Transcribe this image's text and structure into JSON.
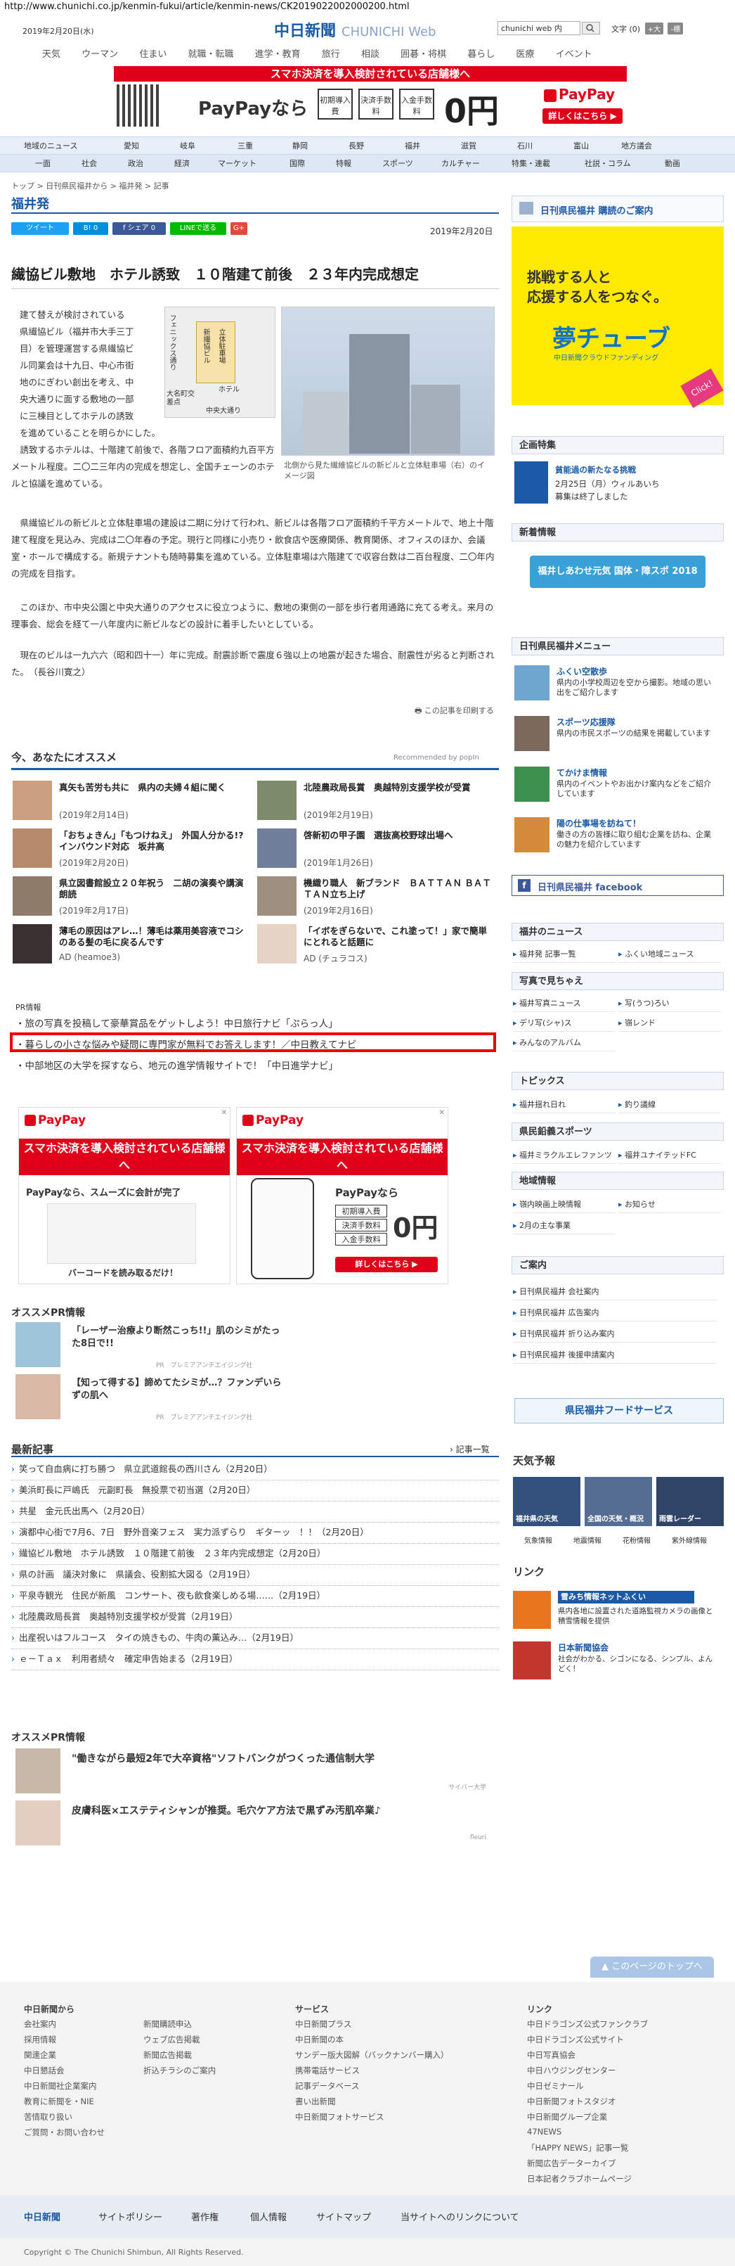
{
  "browser": {
    "url": "http://www.chunichi.co.jp/kenmin-fukui/article/kenmin-news/CK2019022002000200.html"
  },
  "header": {
    "date": "2019年2月20日(水)",
    "logo": "中日新聞",
    "logo_sub": "CHUNICHI Web",
    "search_value": "chunichi web 内",
    "font_size_label": "文字",
    "font_size_value": "(0)",
    "font_bigger": "+大",
    "font_smaller": "-標"
  },
  "global_nav": [
    "天気",
    "ウーマン",
    "住まい",
    "就職・転職",
    "進学・教育",
    "旅行",
    "相談",
    "囲碁・将棋",
    "暮らし",
    "医療",
    "イベント"
  ],
  "top_banner": {
    "red_text": "スマホ決済を導入検討されている店舗様へ",
    "brand": "PayPay",
    "brand_prefix": "PayPayなら",
    "badges": [
      "初期導入費",
      "決済手数料",
      "入金手数料"
    ],
    "price": "0円",
    "cta": "詳しくはこちら ▶"
  },
  "nav_primary": [
    "地域のニュース",
    "愛知",
    "岐阜",
    "三重",
    "静岡",
    "長野",
    "福井",
    "滋賀",
    "石川",
    "富山",
    "地方議会"
  ],
  "nav_secondary": [
    "一面",
    "社会",
    "政治",
    "経済",
    "マーケット",
    "国際",
    "特報",
    "スポーツ",
    "カルチャー",
    "特集・連載",
    "社説・コラム",
    "動画"
  ],
  "breadcrumb": "トップ > 日刊県民福井から > 福井発 > 記事",
  "section_title": "福井発",
  "share_buttons": [
    {
      "label": "ツイート",
      "color": "#1da1f2"
    },
    {
      "label": "B! 0",
      "color": "#008fde"
    },
    {
      "label": "f シェア 0",
      "color": "#3b5998"
    },
    {
      "label": "LINEで送る",
      "color": "#00b900"
    },
    {
      "label": "G+",
      "color": "#dd4b39"
    }
  ],
  "article": {
    "date": "2019年2月20日",
    "headline": "繊協ビル敷地　ホテル誘致　１０階建て前後　２３年内完成想定",
    "para1_lines": [
      "建て替えが検討されている",
      "県繊協ビル（福井市大手三丁",
      "目）を管理運営する県繊協ビ",
      "ル同業会は十九日、中心市街",
      "地のにぎわい創出を考え、中",
      "央大通りに面する敷地の一部",
      "に三棟目としてホテルの誘致",
      "を進めていることを明らかにした。"
    ],
    "para2": "誘致するホテルは、十階建て前後で、各階フロア面積約九百平方メートル程度。二〇二三年内の完成を想定し、全国チェーンのホテルと協議を進めている。",
    "para3": "県繊協ビルの新ビルと立体駐車場の建設は二期に分けて行われ、新ビルは各階フロア面積約千平方メートルで、地上十階建て程度を見込み、完成は二〇年春の予定。現行と同様に小売り・飲食店や医療関係、教育関係、オフィスのほか、会議室・ホールで構成する。新規テナントも随時募集を進めている。立体駐車場は六階建てで収容台数は二百台程度、二〇年内の完成を目指す。",
    "para4": "このほか、市中央公園と中央大通りのアクセスに役立つように、敷地の東側の一部を歩行者用通路に充てる考え。来月の理事会、総会を経て一八年度内に新ビルなどの設計に着手したいとしている。",
    "para5": "現在のビルは一九六六（昭和四十一）年に完成。耐震診断で震度６強以上の地震が起きた場合、耐震性が劣ると判断された。　（長谷川寛之）",
    "map_labels": [
      "フェニックス通り",
      "新繊協ビル",
      "立体駐車場",
      "大名町交差点",
      "ホテル",
      "中央大通り"
    ],
    "photo_caption": "北側から見た繊維協ビルの新ビルと立体駐車場（右）のイメージ図",
    "print_link": "この記事を印刷する"
  },
  "recommend": {
    "title": "今、あなたにオススメ",
    "powered": "Recommended by popIn",
    "items": [
      {
        "title": "真矢も苦労も共に　県内の夫婦４組に聞く",
        "date": "(2019年2月14日)"
      },
      {
        "title": "北陸農政局長賞　奥越特別支援学校が受賞",
        "date": "(2019年2月19日)"
      },
      {
        "title": "「おちょきん」「もつけねえ」　外国人分かる!?　インバウンド対応　坂井高",
        "date": "(2019年2月20日)"
      },
      {
        "title": "啓新初の甲子園　選抜高校野球出場へ",
        "date": "(2019年1月26日)"
      },
      {
        "title": "県立図書館設立２０年祝う　二胡の演奏や講演朗読",
        "date": "(2019年2月17日)"
      },
      {
        "title": "機織り職人　新ブランド　ＢＡＴＴＡＮ ＢＡＴＴＡＮ立ち上げ",
        "date": "(2019年2月16日)"
      },
      {
        "title": "薄毛の原因はアレ…！薄毛は薬用美容液でコシのある髪の毛に戻るんです",
        "date": "AD (heamoe3)"
      },
      {
        "title": "「イボをぎらないで、これ塗って！」家で簡単にとれると話題に",
        "date": "AD (チュラコス)"
      }
    ]
  },
  "pr_info": {
    "label": "PR情報",
    "links": [
      "旅の写真を投稿して豪華賞品をゲットしよう！中日旅行ナビ「ぷらっ人」",
      "暮らしの小さな悩みや疑問に専門家が無料でお答えします！／中日教えてナビ",
      "中部地区の大学を探すなら、地元の進学情報サイトで！「中日進学ナビ」"
    ]
  },
  "paypay_ads": [
    {
      "brand": "PayPay",
      "red_text": "スマホ決済を導入検討されている店舗様へ",
      "sub": "PayPayなら、スムーズに会計が完了",
      "note": "バーコードを読み取るだけ！"
    },
    {
      "brand": "PayPay",
      "red_text": "スマホ決済を導入検討されている店舗様へ",
      "sub": "PayPayなら",
      "badges": [
        "初期導入費",
        "決済手数料",
        "入金手数料"
      ],
      "price": "0円",
      "cta": "詳しくはこちら ▶"
    }
  ],
  "pr_recommend_1": {
    "title": "オススメPR情報",
    "items": [
      {
        "title": "「レーザー治療より断然こっち!!」肌のシミがたった8日で!!",
        "source": "PR　プレミアアンチエイジング社"
      },
      {
        "title": "【知って得する】諦めてたシミが…？ファンデいらずの肌へ",
        "source": "PR　プレミアアンチエイジング社"
      }
    ]
  },
  "latest": {
    "title": "最新記事",
    "more": "› 記事一覧",
    "items": [
      "笑って自血病に打ち勝つ　県立武道館長の西川さん（2月20日）",
      "美浜町長に戸嶋氏　元副町長　無投票で初当選（2月20日）",
      "共星　金元氏出馬へ（2月20日）",
      "演都中心街で7月6、7日　野外音楽フェス　実力派ずらり　ギターッ　！！（2月20日）",
      "繊協ビル敷地　ホテル誘致　１０階建て前後　２３年内完成想定（2月20日）",
      "県の計画　議決対象に　県議会、役割拡大図る（2月19日）",
      "平泉寺観光　住民が新風　コンサート、夜も飲食楽しめる場……（2月19日）",
      "北陸農政局長賞　奥越特別支援学校が受賞（2月19日）",
      "出産祝いはフルコース　タイの焼きもの、牛肉の薫込み…（2月19日）",
      "ｅ－Ｔａｘ　利用者続々　確定申告始まる（2月19日）"
    ]
  },
  "pr_recommend_2": {
    "title": "オススメPR情報",
    "items": [
      {
        "title": "\"働きながら最短2年で大卒資格\"ソフトバンクがつくった通信制大学",
        "source": "サイバー大学"
      },
      {
        "title": "皮膚科医×エステティシャンが推奨。毛穴ケア方法で黒ずみ汚肌卒業♪",
        "source": "fleuri"
      }
    ]
  },
  "sidebar": {
    "purchase_title": "日刊県民福井 購読のご案内",
    "yume_ad": {
      "line1": "挑戦する人と",
      "line2": "応援する人をつなぐ。",
      "brand": "夢チューブ",
      "sub": "中日新聞クラウドファンディング",
      "click": "Click!"
    },
    "feature_title": "企画特集",
    "feature_item": {
      "title": "貧能過の新たなる挑戦",
      "date": "2月25日（月）ウィルあいち",
      "desc": "募集は終了しました"
    },
    "new_info_title": "新着情報",
    "new_info_banner": "福井しあわせ元気 国体・障スポ 2018",
    "menu_title": "日刊県民福井メニュー",
    "menu_items": [
      {
        "title": "ふくい空散歩",
        "desc": "県内の小学校周辺を空から撮影。地域の思い出をご紹介します"
      },
      {
        "title": "スポーツ応援隊",
        "desc": "県内の市民スポーツの結果を掲載しています"
      },
      {
        "title": "てかけま情報",
        "desc": "県内のイベントやお出かけ案内などをご紹介しています"
      },
      {
        "title": "陽の仕事場を訪ねて！",
        "desc": "働きの方の皆様に取り組む企業を訪ね、企業の魅力を紹介しています"
      }
    ],
    "facebook": "日刊県民福井 facebook",
    "fukui_news_title": "福井のニュース",
    "fukui_news": [
      "福井発 記事一覧",
      "ふくい地域ニュース"
    ],
    "photo_title": "写真で見ちゃえ",
    "photo_items": [
      "福井写真ニュース",
      "写(うつ)ろい",
      "デリ写(シャ)ス",
      "嶺レンド",
      "みんなのアルバム"
    ],
    "topics_title": "トピックス",
    "topics_items": [
      "福井揺れ日れ",
      "釣り議線"
    ],
    "sports_title": "県民鉛義スポーツ",
    "sports_items": [
      "福井ミラクルエレファンツ",
      "福井ユナイテッドFC"
    ],
    "region_title": "地域情報",
    "region_items": [
      "嶺内映画上映情報",
      "お知らせ",
      "2月の主な事業"
    ],
    "guide_title": "ご案内",
    "guide_items": [
      "日刊県民福井 会社案内",
      "日刊県民福井 広告案内",
      "日刊県民福井 折り込み案内",
      "日刊県民福井 後援申請案内"
    ],
    "service_banner": "県民福井フードサービス",
    "weather_title": "天気予報",
    "weather_tiles": [
      "福井県の天気",
      "全国の天気・概況",
      "雨雲レーダー"
    ],
    "weather_links": [
      "気象情報",
      "地震情報",
      "花粉情報",
      "紫外線情報"
    ],
    "link_title": "リンク",
    "link_items": [
      {
        "title": "雪みち情報ネットふくい",
        "desc": "県内各地に設置された道路監視カメラの画像と積雪情報を提供"
      },
      {
        "title": "日本新聞協会",
        "desc": "社会がわかる、シゴンになる、シンプル、よんどく！"
      }
    ]
  },
  "page_top": "このページのトップへ",
  "footer": {
    "col1_title": "中日新聞から",
    "col1": [
      "会社案内",
      "採用情報",
      "関連企業",
      "中日懇話会",
      "中日新聞社企業案内",
      "教育に新聞を・NIE",
      "苦情取り扱い",
      "ご質問・お問い合わせ"
    ],
    "col2": [
      "新聞購読申込",
      "ウェブ広告掲載",
      "新聞広告掲載",
      "折込チラシのご案内"
    ],
    "col3_title": "サービス",
    "col3": [
      "中日新聞プラス",
      "中日新聞の本",
      "サンデー版大図解（バックナンバー購入）",
      "携帯電話サービス",
      "記事データベース",
      "書い出新聞",
      "中日新聞フォトサービス"
    ],
    "col4_title": "リンク",
    "col4": [
      "中日ドラゴンズ公式ファンクラブ",
      "中日ドラゴンズ公式サイト",
      "中日写真協会",
      "中日ハウジングセンター",
      "中日ゼミナール",
      "中日新聞フォトスタジオ",
      "中日新聞グループ企業",
      "47NEWS",
      "「HAPPY NEWS」記事一覧",
      "新聞広告データーカイブ",
      "日本記者クラブホームページ"
    ]
  },
  "bottom_nav": [
    "中日新聞",
    "サイトポリシー",
    "著作権",
    "個人情報",
    "サイトマップ",
    "当サイトへのリンクについて"
  ],
  "copyright": "Copyright © The Chunichi Shimbun, All Rights Reserved."
}
